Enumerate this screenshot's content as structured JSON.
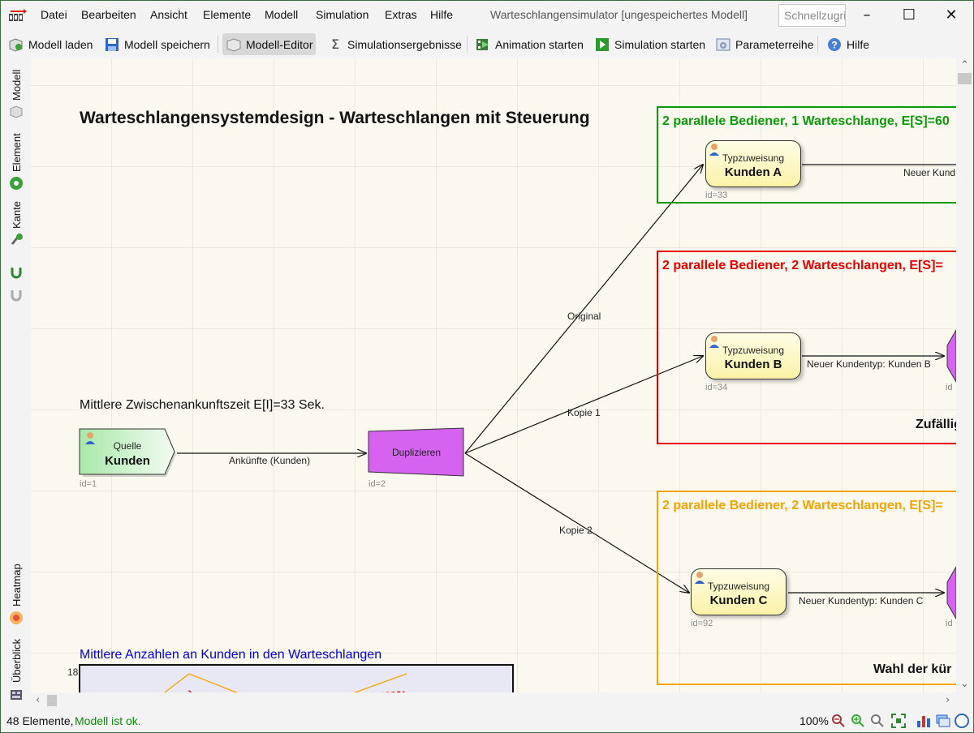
{
  "menu": [
    "Datei",
    "Bearbeiten",
    "Ansicht",
    "Elemente",
    "Modell",
    "Simulation",
    "Extras",
    "Hilfe"
  ],
  "window_title": "Warteschlangensimulator [ungespeichertes Modell]",
  "quick_access_placeholder": "Schnellzugriff",
  "toolbar": {
    "load": "Modell laden",
    "save": "Modell speichern",
    "editor": "Modell-Editor",
    "results": "Simulationsergebnisse",
    "animation": "Animation starten",
    "simulation": "Simulation starten",
    "params": "Parameterreihe",
    "help": "Hilfe"
  },
  "sidebar": {
    "model": "Modell",
    "element": "Element",
    "edge": "Kante",
    "heatmap": "Heatmap",
    "overview": "Überblick"
  },
  "model": {
    "title": "Warteschlangensystemdesign - Warteschlangen mit Steuerung",
    "interarrival_text": "Mittlere Zwischenankunftszeit E[I]=33 Sek.",
    "chart_caption": "Mittlere Anzahlen an Kunden in den Warteschlangen",
    "chart_axis_top": "18",
    "box_green_title": "2 parallele Bediener, 1 Warteschlange, E[S]=60",
    "box_red_title": "2 parallele Bediener, 2 Warteschlangen, E[S]=",
    "box_red_footer": "Zufällig",
    "box_orange_title": "2 parallele Bediener, 2 Warteschlangen, E[S]=",
    "box_orange_footer": "Wahl der kür",
    "source": {
      "sub": "Quelle",
      "main": "Kunden",
      "id": "id=1"
    },
    "duplicate": {
      "main": "Duplizieren",
      "id": "id=2"
    },
    "type_a": {
      "sub": "Typzuweisung",
      "main": "Kunden A",
      "id": "id=33"
    },
    "type_b": {
      "sub": "Typzuweisung",
      "main": "Kunden B",
      "id": "id=34"
    },
    "type_c": {
      "sub": "Typzuweisung",
      "main": "Kunden C",
      "id": "id=92"
    },
    "edges": {
      "arrivals": "Ankünfte (Kunden)",
      "original": "Original",
      "copy1": "Kopie 1",
      "copy2": "Kopie 2",
      "new_a": "Neuer Kund",
      "new_b": "Neuer Kundentyp: Kunden B",
      "new_c": "Neuer Kundentyp: Kunden C"
    },
    "id_b_right": "id",
    "id_c_right": "id"
  },
  "status": {
    "elements": "48 Elemente,",
    "ok": "Modell ist ok.",
    "zoom": "100%"
  },
  "colors": {
    "green": "#0a9a0a",
    "red": "#e60000",
    "orange": "#f5a300",
    "blue": "#0000dd",
    "duplicate_fill": "#d563f0"
  }
}
